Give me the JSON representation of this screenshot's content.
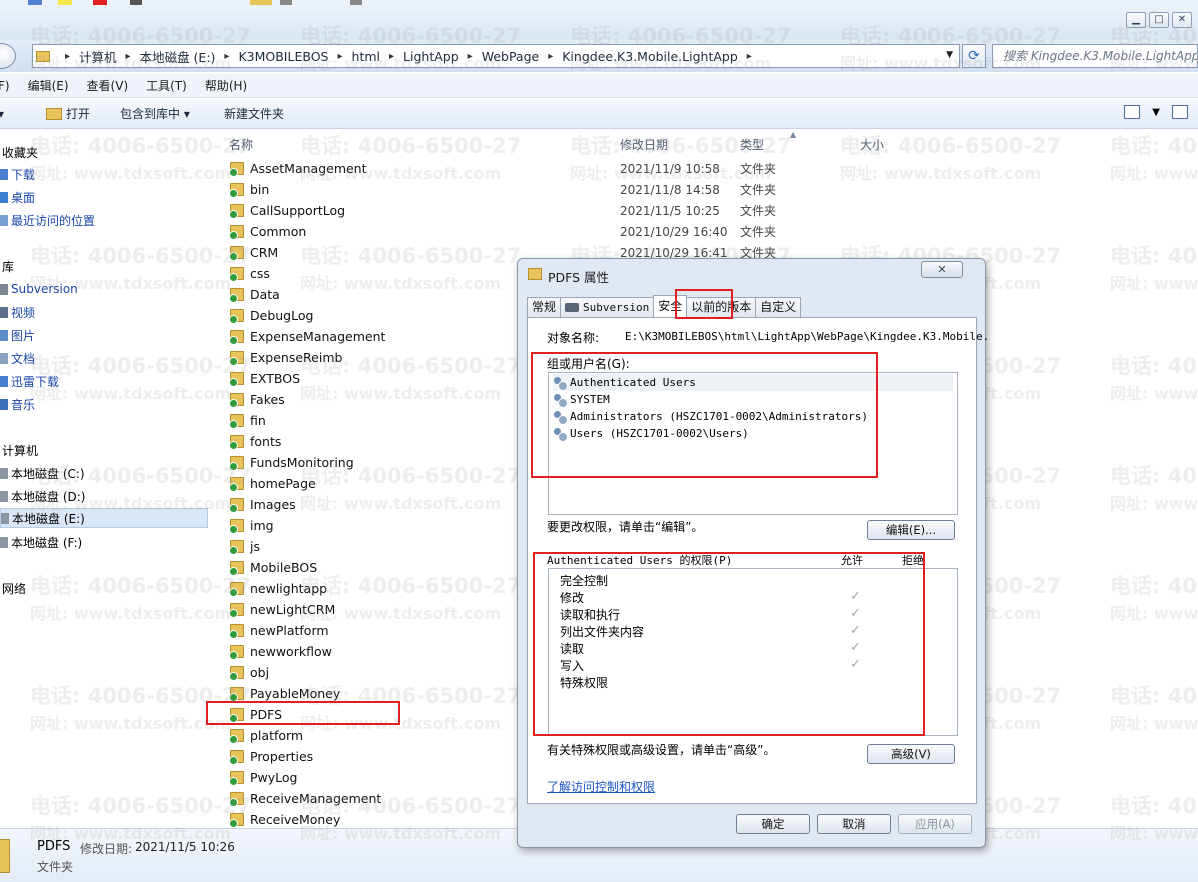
{
  "address": {
    "crumbs": [
      "计算机",
      "本地磁盘 (E:)",
      "K3MOBILEBOS",
      "html",
      "LightApp",
      "WebPage",
      "Kingdee.K3.Mobile.LightApp"
    ],
    "search_placeholder": "搜索 Kingdee.K3.Mobile.LightApp"
  },
  "menu": [
    "F)",
    "编辑(E)",
    "查看(V)",
    "工具(T)",
    "帮助(H)"
  ],
  "toolbar": {
    "open": "打开",
    "include_library": "包含到库中 ▾",
    "new_folder": "新建文件夹"
  },
  "nav": {
    "favorites": "收藏夹",
    "favorites_items": [
      "下载",
      "桌面",
      "最近访问的位置"
    ],
    "library": "库",
    "library_items": [
      "Subversion",
      "视频",
      "图片",
      "文档",
      "迅雷下载",
      "音乐"
    ],
    "computer": "计算机",
    "drives": [
      "本地磁盘 (C:)",
      "本地磁盘 (D:)",
      "本地磁盘 (E:)",
      "本地磁盘 (F:)"
    ],
    "network": "网络"
  },
  "columns": {
    "name": "名称",
    "date": "修改日期",
    "type": "类型",
    "size": "大小"
  },
  "files": [
    {
      "name": "AssetManagement",
      "date": "2021/11/9 10:58",
      "type": "文件夹"
    },
    {
      "name": "bin",
      "date": "2021/11/8 14:58",
      "type": "文件夹"
    },
    {
      "name": "CallSupportLog",
      "date": "2021/11/5 10:25",
      "type": "文件夹"
    },
    {
      "name": "Common",
      "date": "2021/10/29 16:40",
      "type": "文件夹"
    },
    {
      "name": "CRM",
      "date": "2021/10/29 16:41",
      "type": "文件夹"
    },
    {
      "name": "css",
      "date": "",
      "type": ""
    },
    {
      "name": "Data",
      "date": "",
      "type": ""
    },
    {
      "name": "DebugLog",
      "date": "",
      "type": ""
    },
    {
      "name": "ExpenseManagement",
      "date": "",
      "type": ""
    },
    {
      "name": "ExpenseReimb",
      "date": "",
      "type": ""
    },
    {
      "name": "EXTBOS",
      "date": "",
      "type": ""
    },
    {
      "name": "Fakes",
      "date": "",
      "type": ""
    },
    {
      "name": "fin",
      "date": "",
      "type": ""
    },
    {
      "name": "fonts",
      "date": "",
      "type": ""
    },
    {
      "name": "FundsMonitoring",
      "date": "",
      "type": ""
    },
    {
      "name": "homePage",
      "date": "",
      "type": ""
    },
    {
      "name": "Images",
      "date": "",
      "type": ""
    },
    {
      "name": "img",
      "date": "",
      "type": ""
    },
    {
      "name": "js",
      "date": "",
      "type": ""
    },
    {
      "name": "MobileBOS",
      "date": "",
      "type": ""
    },
    {
      "name": "newlightapp",
      "date": "",
      "type": ""
    },
    {
      "name": "newLightCRM",
      "date": "",
      "type": ""
    },
    {
      "name": "newPlatform",
      "date": "",
      "type": ""
    },
    {
      "name": "newworkflow",
      "date": "",
      "type": ""
    },
    {
      "name": "obj",
      "date": "",
      "type": ""
    },
    {
      "name": "PayableMoney",
      "date": "",
      "type": ""
    },
    {
      "name": "PDFS",
      "date": "",
      "type": ""
    },
    {
      "name": "platform",
      "date": "",
      "type": ""
    },
    {
      "name": "Properties",
      "date": "",
      "type": ""
    },
    {
      "name": "PwyLog",
      "date": "",
      "type": ""
    },
    {
      "name": "ReceiveManagement",
      "date": "",
      "type": ""
    },
    {
      "name": "ReceiveMoney",
      "date": "",
      "type": ""
    }
  ],
  "status": {
    "name": "PDFS",
    "modified_label": "修改日期:",
    "modified": "2021/11/5 10:26",
    "type": "文件夹"
  },
  "dialog": {
    "title": "PDFS 属性",
    "close": "✕",
    "tabs": [
      "常规",
      "Subversion",
      "安全",
      "以前的版本",
      "自定义"
    ],
    "object_label": "对象名称:",
    "object_value": "E:\\K3MOBILEBOS\\html\\LightApp\\WebPage\\Kingdee.K3.Mobile.",
    "group_label": "组或用户名(G):",
    "users": [
      "Authenticated Users",
      "SYSTEM",
      "Administrators (HSZC1701-0002\\Administrators)",
      "Users (HSZC1701-0002\\Users)"
    ],
    "edit_hint": "要更改权限，请单击“编辑”。",
    "edit_button": "编辑(E)...",
    "perm_header": "Authenticated Users 的权限(P)",
    "allow": "允许",
    "deny": "拒绝",
    "permissions": [
      "完全控制",
      "修改",
      "读取和执行",
      "列出文件夹内容",
      "读取",
      "写入",
      "特殊权限"
    ],
    "checks": [
      "",
      "✓",
      "✓",
      "✓",
      "✓",
      "✓",
      ""
    ],
    "advanced_hint": "有关特殊权限或高级设置，请单击“高级”。",
    "advanced_button": "高级(V)",
    "learn_link": "了解访问控制和权限",
    "ok": "确定",
    "cancel": "取消",
    "apply": "应用(A)"
  },
  "watermark": {
    "phone": "电话: 4006-6500-27",
    "site": "网址: www.tdxsoft.com"
  },
  "colors": {
    "annotation_red": "#e02020",
    "link_blue": "#1e55c6",
    "folder_yellow": "#e8c35a",
    "badge_green": "#2f9d3c"
  }
}
